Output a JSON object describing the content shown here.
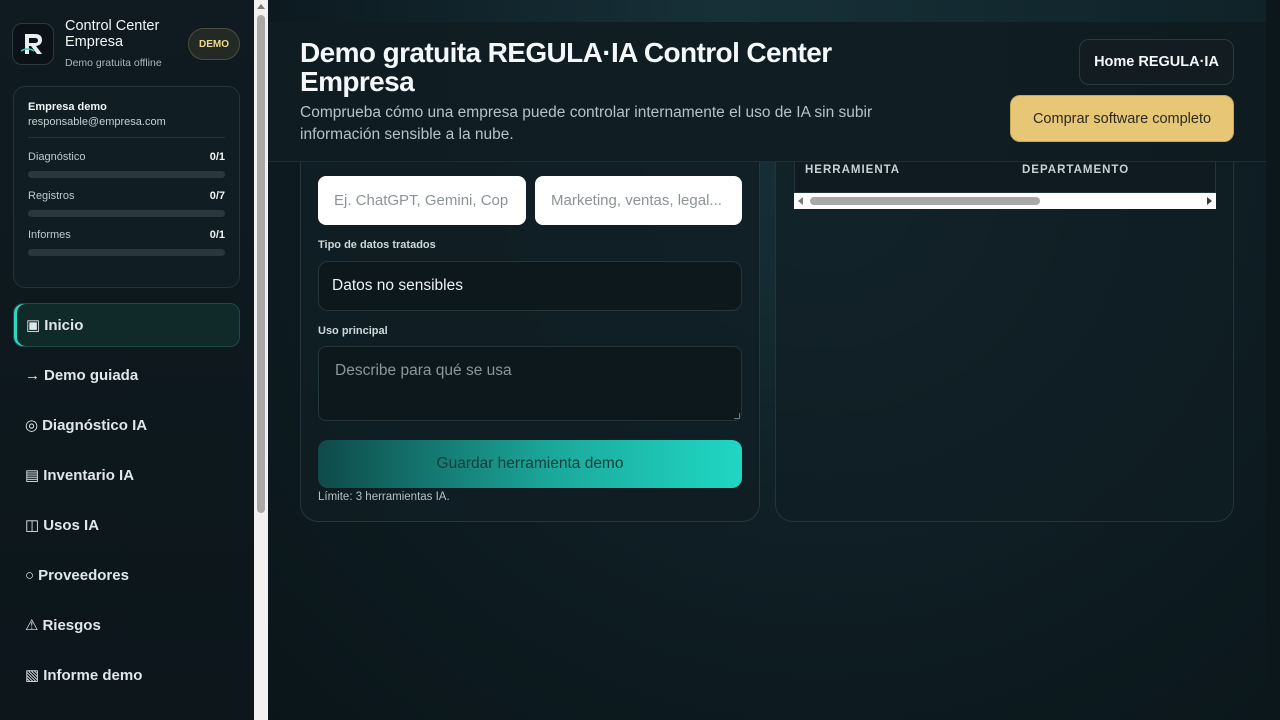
{
  "sidebar": {
    "brand_title": "Control Center Empresa",
    "brand_subtitle": "Demo gratuita offline",
    "badge": "DEMO",
    "company": {
      "name": "Empresa demo",
      "email": "responsable@empresa.com"
    },
    "metrics": [
      {
        "label": "Diagnóstico",
        "value": "0/1",
        "progress": 0
      },
      {
        "label": "Registros",
        "value": "0/7",
        "progress": 0
      },
      {
        "label": "Informes",
        "value": "0/1",
        "progress": 0
      }
    ],
    "nav": [
      {
        "icon": "▣",
        "label": "Inicio",
        "active": true
      },
      {
        "icon": "→",
        "label": "Demo guiada"
      },
      {
        "icon": "◎",
        "label": "Diagnóstico IA"
      },
      {
        "icon": "▤",
        "label": "Inventario IA"
      },
      {
        "icon": "◫",
        "label": "Usos IA"
      },
      {
        "icon": "○",
        "label": "Proveedores"
      },
      {
        "icon": "⚠",
        "label": "Riesgos"
      },
      {
        "icon": "▧",
        "label": "Informe demo"
      }
    ]
  },
  "header": {
    "title": "Demo gratuita REGULA·IA Control Center Empresa",
    "subtitle": "Comprueba cómo una empresa puede controlar internamente el uso de IA sin subir información sensible a la nube.",
    "home_button": "Home REGULA·IA",
    "buy_button": "Comprar software completo"
  },
  "form": {
    "tool_placeholder": "Ej. ChatGPT, Gemini, Cop",
    "department_placeholder": "Marketing, ventas, legal...",
    "data_type_label": "Tipo de datos tratados",
    "data_type_value": "Datos no sensibles",
    "usage_label": "Uso principal",
    "usage_placeholder": "Describe para qué se usa",
    "save_button": "Guardar herramienta demo",
    "limit_note": "Límite: 3 herramientas IA."
  },
  "table": {
    "columns": [
      "HERRAMIENTA",
      "DEPARTAMENTO"
    ],
    "rows": []
  },
  "colors": {
    "accent": "#1fd7c4",
    "gold": "#e7c776",
    "background": "#0b1419"
  }
}
